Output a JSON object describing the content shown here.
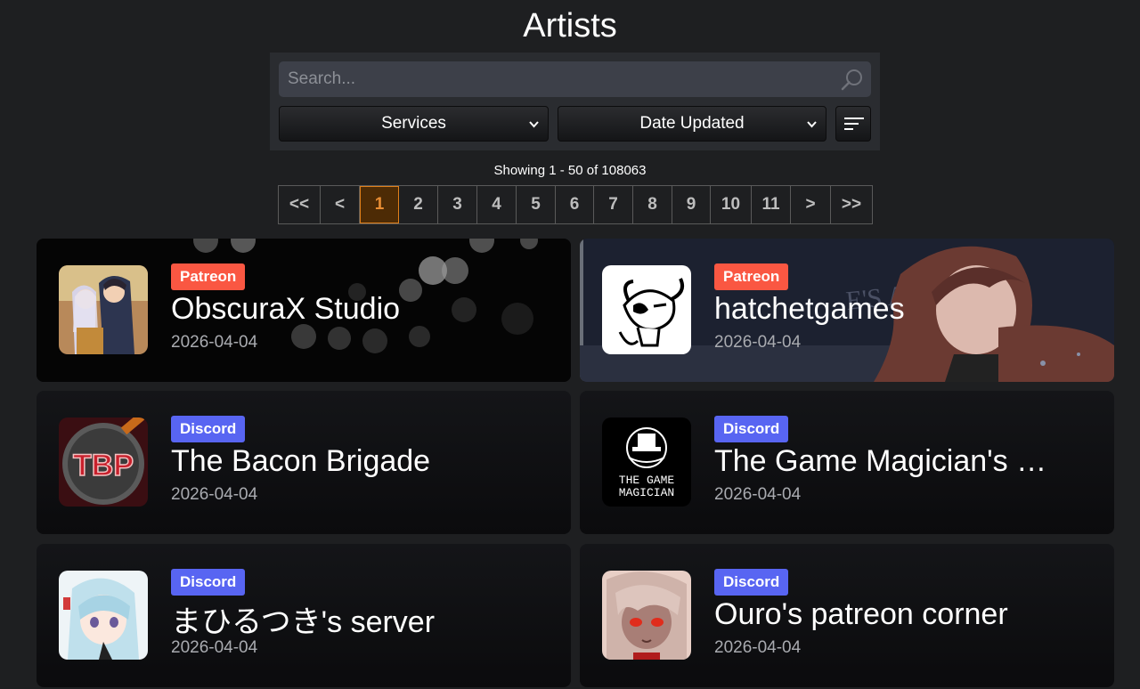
{
  "page": {
    "title": "Artists"
  },
  "search": {
    "placeholder": "Search..."
  },
  "filters": {
    "service": "Services",
    "sort": "Date Updated"
  },
  "results": {
    "showing": "Showing 1 - 50 of 108063"
  },
  "pagination": {
    "first": "<<",
    "prev": "<",
    "pages": [
      "1",
      "2",
      "3",
      "4",
      "5",
      "6",
      "7",
      "8",
      "9",
      "10",
      "11"
    ],
    "current": "1",
    "next": ">",
    "last": ">>"
  },
  "artists": [
    {
      "service": "Patreon",
      "name": "ObscuraX Studio",
      "updated": "2026-04-04",
      "avatar": "anime-couple-avatar-icon"
    },
    {
      "service": "Patreon",
      "name": "hatchetgames",
      "updated": "2026-04-04",
      "avatar": "cartoon-demon-avatar-icon"
    },
    {
      "service": "Discord",
      "name": "The Bacon Brigade",
      "updated": "2026-04-04",
      "avatar": "tbp-logo-avatar-icon"
    },
    {
      "service": "Discord",
      "name": "The Game Magician's …",
      "updated": "2026-04-04",
      "avatar": "game-magician-logo-icon"
    },
    {
      "service": "Discord",
      "name": "まひるつき's server",
      "updated": "2026-04-04",
      "avatar": "anime-girl-avatar-icon"
    },
    {
      "service": "Discord",
      "name": "Ouro's patreon corner",
      "updated": "2026-04-04",
      "avatar": "red-eyed-girl-avatar-icon"
    }
  ],
  "colors": {
    "patreon": "#fa5742",
    "discord": "#5865f2",
    "accent": "#e0801b"
  }
}
